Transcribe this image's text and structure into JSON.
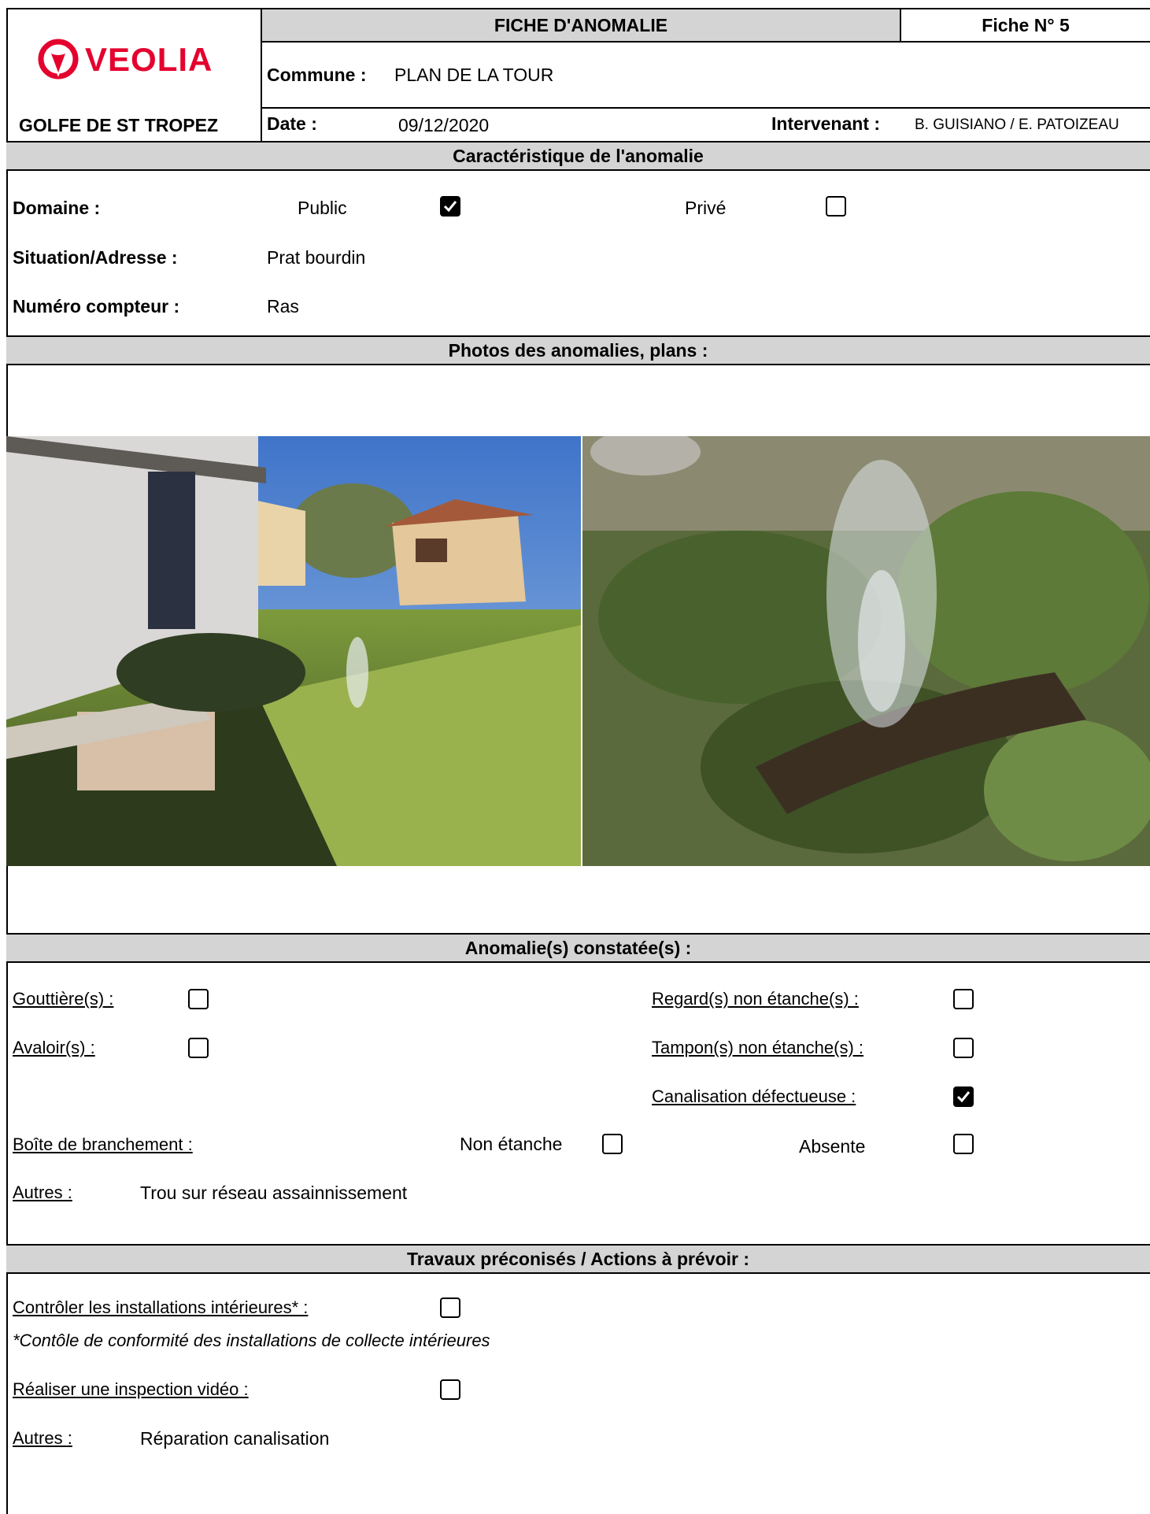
{
  "header": {
    "brand": "VEOLIA",
    "region": "GOLFE DE ST TROPEZ",
    "form_title": "FICHE D'ANOMALIE",
    "fiche_label": "Fiche N°",
    "fiche_number": "5",
    "commune_label": "Commune :",
    "commune_value": "PLAN DE LA TOUR",
    "date_label": "Date :",
    "date_value": "09/12/2020",
    "intervenant_label": "Intervenant :",
    "intervenant_value": "B. GUISIANO / E. PATOIZEAU"
  },
  "caracteristique": {
    "title": "Caractéristique de l'anomalie",
    "domaine_label": "Domaine :",
    "public_label": "Public",
    "public_checked": true,
    "prive_label": "Privé",
    "prive_checked": false,
    "situation_label": "Situation/Adresse :",
    "situation_value": "Prat bourdin",
    "compteur_label": "Numéro compteur :",
    "compteur_value": "Ras"
  },
  "photos": {
    "title": "Photos des anomalies, plans :",
    "items": [
      "garden-house-photo",
      "grass-leak-closeup-photo"
    ]
  },
  "anomalies": {
    "title": "Anomalie(s) constatée(s) :",
    "gouttieres_label": "Gouttière(s) :",
    "gouttieres_checked": false,
    "avaloirs_label": "Avaloir(s) :",
    "avaloirs_checked": false,
    "regards_label": "Regard(s) non étanche(s) :",
    "regards_checked": false,
    "tampons_label": "Tampon(s) non étanche(s) :",
    "tampons_checked": false,
    "canalisation_label": "Canalisation défectueuse :",
    "canalisation_checked": true,
    "boite_label": "Boîte de branchement :",
    "non_etanche_label": "Non étanche",
    "non_etanche_checked": false,
    "absente_label": "Absente",
    "absente_checked": false,
    "autres_label": "Autres :",
    "autres_value": "Trou sur réseau assainnissement"
  },
  "travaux": {
    "title": "Travaux préconisés / Actions à prévoir :",
    "controler_label": "Contrôler les installations intérieures* :",
    "controler_checked": false,
    "controler_note": "*Contôle de conformité des installations de collecte intérieures",
    "inspection_label": "Réaliser une inspection vidéo :",
    "inspection_checked": false,
    "autres_label": "Autres :",
    "autres_value": "Réparation canalisation"
  },
  "colors": {
    "brand_red": "#e4032e",
    "section_grey": "#d4d4d4"
  }
}
